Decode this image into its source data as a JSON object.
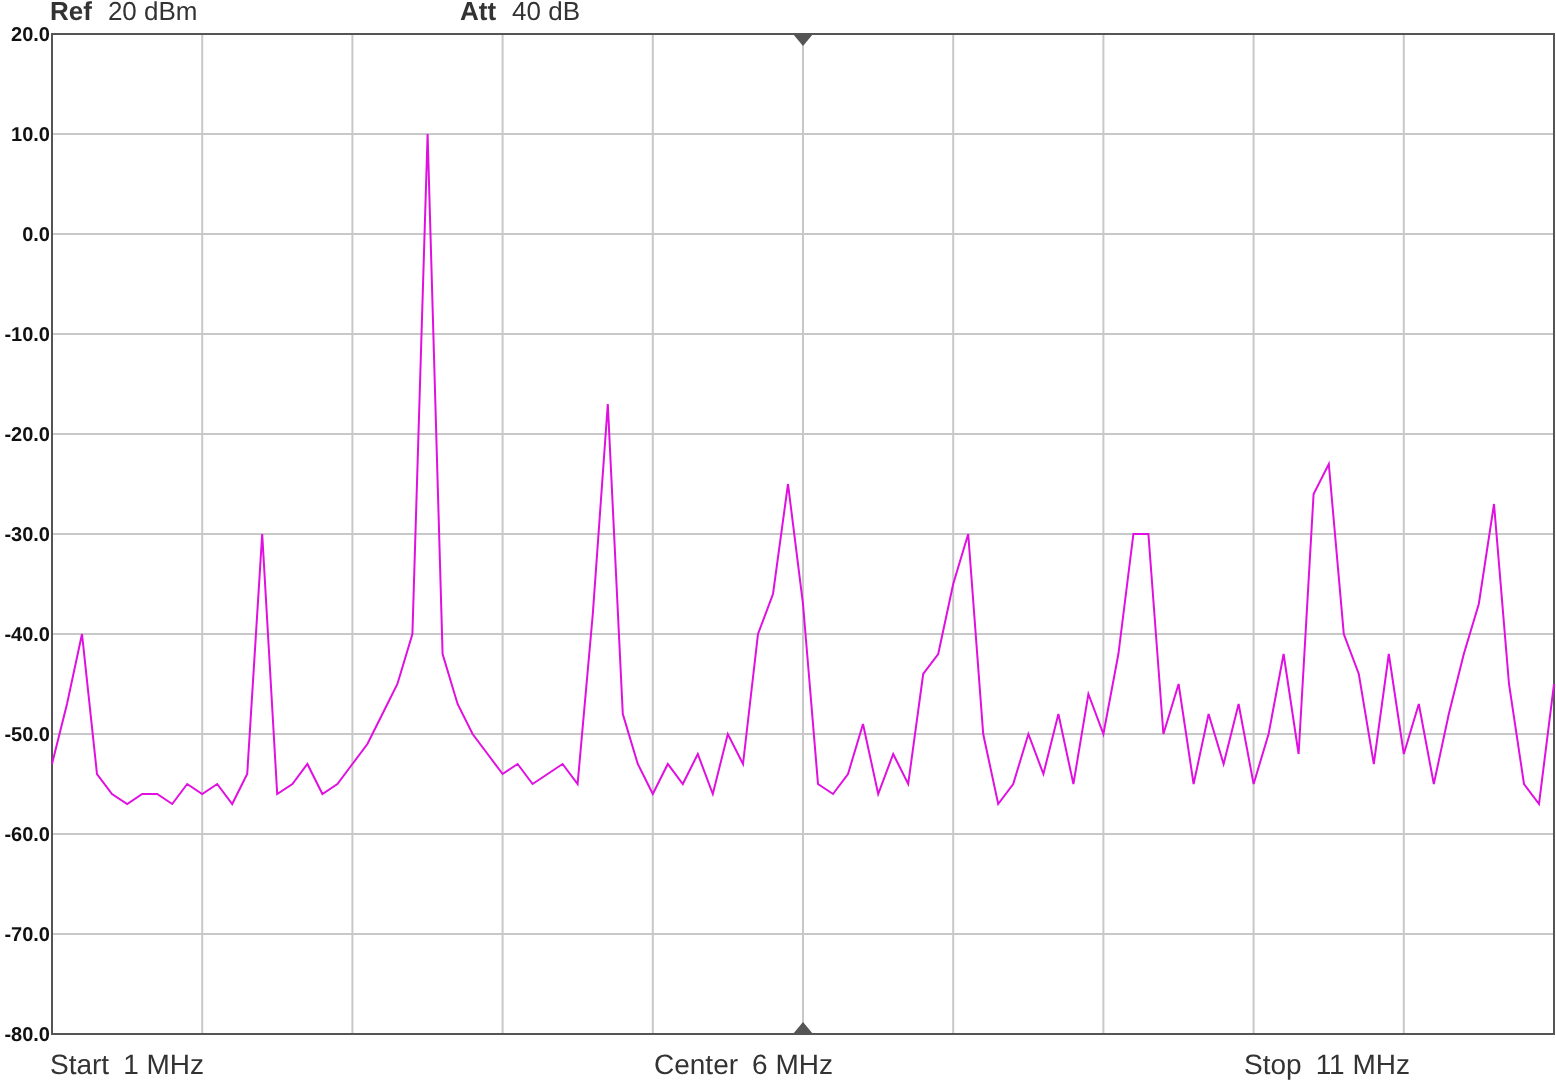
{
  "header": [
    {
      "label": "Ref",
      "value": "20 dBm"
    },
    {
      "label": "Att",
      "value": "40 dB"
    }
  ],
  "chart_data": {
    "type": "line",
    "grid": true,
    "ylim": [
      -80,
      20
    ],
    "categories": [
      null,
      null,
      null,
      null,
      null,
      null,
      null,
      null,
      null,
      null,
      null,
      null,
      null,
      null,
      null,
      null,
      null,
      null,
      null,
      null,
      null,
      null,
      null,
      null,
      null,
      null,
      null,
      null,
      null,
      null,
      null,
      null,
      null,
      null,
      null,
      null,
      null,
      null,
      null,
      null,
      null,
      null,
      null,
      null,
      null,
      null,
      null,
      null,
      null,
      null,
      null,
      null,
      null,
      null,
      null,
      null,
      null,
      null,
      null,
      null,
      null,
      null,
      null,
      null,
      null,
      null,
      null,
      null,
      null,
      null,
      null,
      null,
      null,
      null,
      null,
      null,
      null,
      null,
      null,
      null,
      null,
      null,
      null,
      null,
      null,
      null,
      null,
      null,
      null,
      null,
      null,
      null,
      null,
      null,
      null,
      null,
      null,
      null,
      null,
      null,
      null
    ],
    "yticks": [
      {
        "value": 20,
        "label": "20.0"
      },
      {
        "value": 10,
        "label": "10.0"
      },
      {
        "value": 0,
        "label": "0.0"
      },
      {
        "value": -10,
        "label": "-10.0"
      },
      {
        "value": -20,
        "label": "-20.0"
      },
      {
        "value": -30,
        "label": "-30.0"
      },
      {
        "value": -40,
        "label": "-40.0"
      },
      {
        "value": -50,
        "label": "-50.0"
      },
      {
        "value": -60,
        "label": "-60.0"
      },
      {
        "value": -70,
        "label": "-70.0"
      },
      {
        "value": -80,
        "label": "-80.0"
      }
    ],
    "series": [
      {
        "color": "#e010e0",
        "values": [
          -53,
          -47,
          -40,
          -54,
          -56,
          -57,
          -56,
          -56,
          -57,
          -55,
          -56,
          -55,
          -57,
          -54,
          -30,
          -56,
          -55,
          -53,
          -56,
          -55,
          -53,
          -51,
          -48,
          -45,
          -40,
          10,
          -42,
          -47,
          -50,
          -52,
          -54,
          -53,
          -55,
          -54,
          -53,
          -55,
          -38,
          -17,
          -48,
          -53,
          -56,
          -53,
          -55,
          -52,
          -56,
          -50,
          -53,
          -40,
          -36,
          -25,
          -37,
          -55,
          -56,
          -54,
          -49,
          -56,
          -52,
          -55,
          -44,
          -42,
          -35,
          -30,
          -50,
          -57,
          -55,
          -50,
          -54,
          -48,
          -55,
          -46,
          -50,
          -42,
          -30,
          -30,
          -50,
          -45,
          -55,
          -48,
          -53,
          -47,
          -55,
          -50,
          -42,
          -52,
          -26,
          -23,
          -40,
          -44,
          -53,
          -42,
          -52,
          -47,
          -55,
          -48,
          -42,
          -37,
          -27,
          -45,
          -55,
          -57,
          -45
        ]
      }
    ]
  },
  "footer": [
    {
      "label": "Start",
      "value": "1 MHz"
    },
    {
      "label": "Center",
      "value": "6 MHz"
    },
    {
      "label": "Stop",
      "value": "11 MHz"
    }
  ]
}
